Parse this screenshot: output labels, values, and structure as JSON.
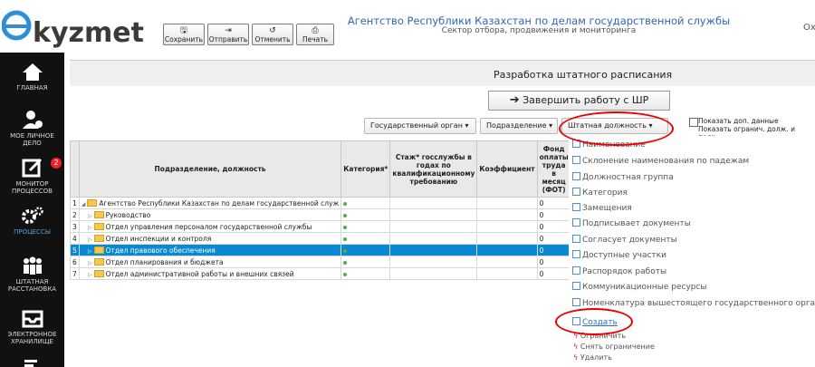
{
  "header": {
    "logo_text": "ekyzmet",
    "toolbar": [
      {
        "label": "Сохранить",
        "icon": "save-icon"
      },
      {
        "label": "Отправить",
        "icon": "send-icon"
      },
      {
        "label": "Отменить",
        "icon": "undo-icon"
      },
      {
        "label": "Печать",
        "icon": "print-icon"
      }
    ],
    "agency": "Агентство Республики Казахстан по делам государственной службы",
    "sector": "Сектор отбора, продвижения и мониторинга",
    "user": "Ох"
  },
  "sidebar": {
    "items": [
      {
        "label": "ГЛАВНАЯ",
        "icon": "home-icon"
      },
      {
        "label": "МОЕ ЛИЧНОЕ ДЕЛО",
        "icon": "personal-file-icon"
      },
      {
        "label": "МОНИТОР ПРОЦЕССОВ",
        "icon": "monitor-edit-icon"
      },
      {
        "label": "ПРОЦЕССЫ",
        "icon": "gears-icon"
      },
      {
        "label": "ШТАТНАЯ РАССТАНОВКА",
        "icon": "staff-icon"
      },
      {
        "label": "ЭЛЕКТРОННОЕ ХРАНИЛИЩЕ",
        "icon": "inbox-icon"
      }
    ],
    "badge": "2",
    "active_color": "#4fa3e0"
  },
  "main": {
    "title": "Разработка штатного расписания",
    "finish_button": "Завершить работу с ШР",
    "filters": [
      "Государственный орган",
      "Подразделение",
      "Штатная должность"
    ],
    "checkbox_label_1": "Показать доп. данные",
    "checkbox_label_2": "Показать огранич. долж. и подр."
  },
  "table": {
    "headers": {
      "name": "Подразделение, должность",
      "category": "Категория*",
      "experience": "Стаж* госслужбы в годах по квалификационному требованию",
      "coef": "Коэффициент",
      "fund": "Фонд оплаты труда в месяц (ФОТ)"
    },
    "rows": [
      {
        "n": "1",
        "name": "Агентство Республики Казахстан по делам государственной служ",
        "fund": "0"
      },
      {
        "n": "2",
        "name": "Руководство",
        "fund": "0"
      },
      {
        "n": "3",
        "name": "Отдел управления персоналом государственной службы",
        "fund": "0"
      },
      {
        "n": "4",
        "name": "Отдел инспекции и контроля",
        "fund": "0"
      },
      {
        "n": "5",
        "name": "Отдел правового обеспечения",
        "fund": "0"
      },
      {
        "n": "6",
        "name": "Отдел планирования и бюджета",
        "fund": "0"
      },
      {
        "n": "7",
        "name": "Отдел административной работы и внешних связей",
        "fund": "0"
      }
    ],
    "selected_color": "#0a88d2"
  },
  "menu": {
    "items": [
      "Наименование",
      "Склонение наименования по падежам",
      "Должностная группа",
      "Категория",
      "Замещения",
      "Подписывает документы",
      "Согласует документы",
      "Доступные участки",
      "Распорядок работы",
      "Коммуникационные ресурсы",
      "Номенклатура вышестоящего государственного органа"
    ],
    "create": "Создать",
    "actions": [
      "Ограничить",
      "Снять ограничение",
      "Удалить"
    ]
  }
}
